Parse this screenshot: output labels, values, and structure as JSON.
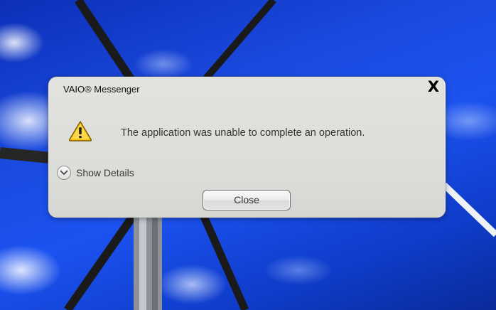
{
  "dialog": {
    "title": "VAIO® Messenger",
    "close_glyph": "X",
    "warning_icon": "warning-triangle-icon",
    "message": "The application was unable to complete an operation.",
    "details_label": "Show Details",
    "details_icon": "chevron-down-icon",
    "close_label": "Close"
  },
  "colors": {
    "dialog_bg": "#dcdcd8",
    "sky_blue": "#1b52f0",
    "warning_yellow": "#f5c400"
  }
}
